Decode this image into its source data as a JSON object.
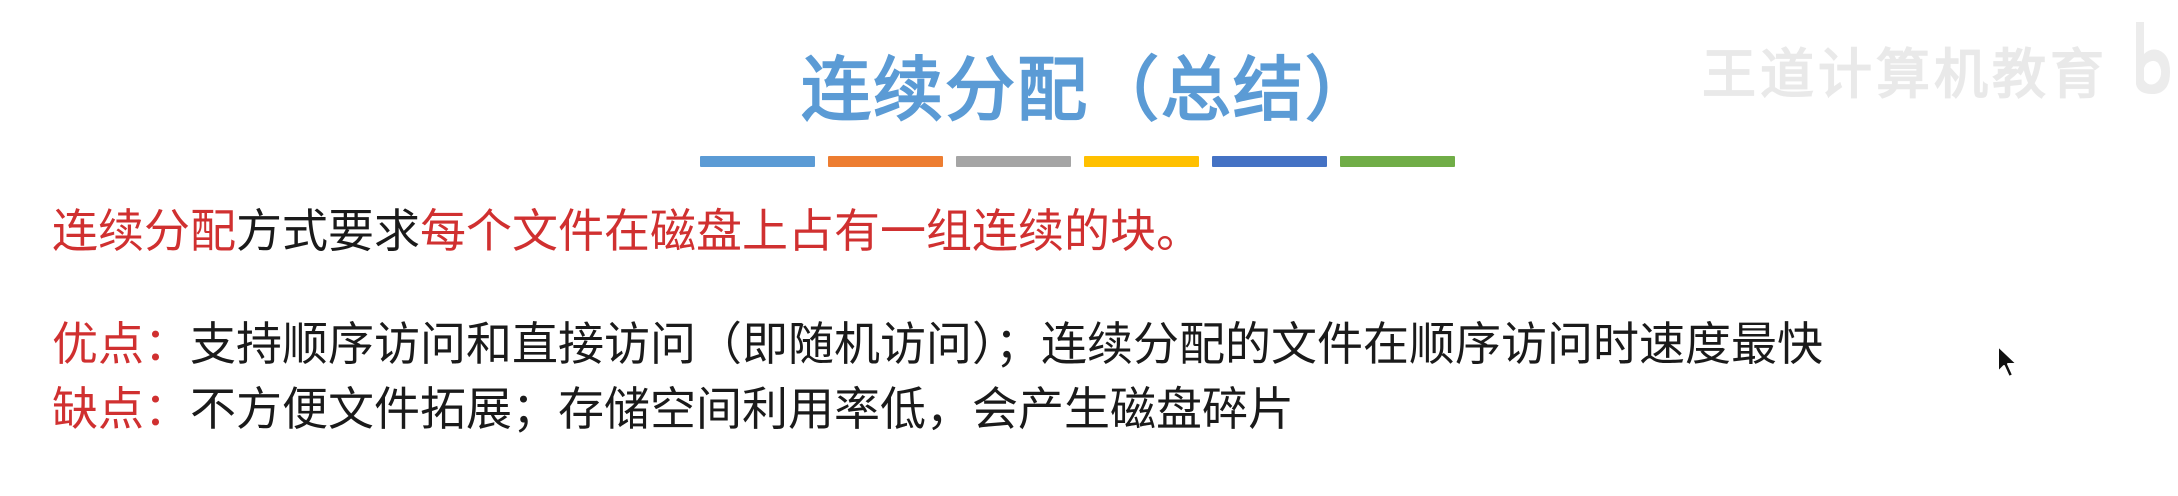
{
  "slide": {
    "title": "连续分配（总结）",
    "line1": {
      "part1": "连续分配",
      "part2": "方式要求",
      "part3": "每个文件在磁盘上占有一组连续的块。"
    },
    "advantages": {
      "label": "优点：",
      "text": "支持顺序访问和直接访问（即随机访问）；连续分配的文件在顺序访问时速度最快"
    },
    "disadvantages": {
      "label": "缺点：",
      "text": "不方便文件拓展；存储空间利用率低，会产生磁盘碎片"
    }
  },
  "watermark": {
    "text": "王道计算机教育"
  },
  "divider_colors": [
    "#5b9bd5",
    "#ed7d31",
    "#a5a5a5",
    "#ffc000",
    "#4472c4",
    "#70ad47"
  ],
  "colors": {
    "title": "#5b9bd5",
    "highlight": "#d03030",
    "text": "#1a1a1a"
  },
  "icons": {
    "cursor": "mouse-cursor-icon",
    "watermark_logo": "watermark-logo-icon"
  }
}
